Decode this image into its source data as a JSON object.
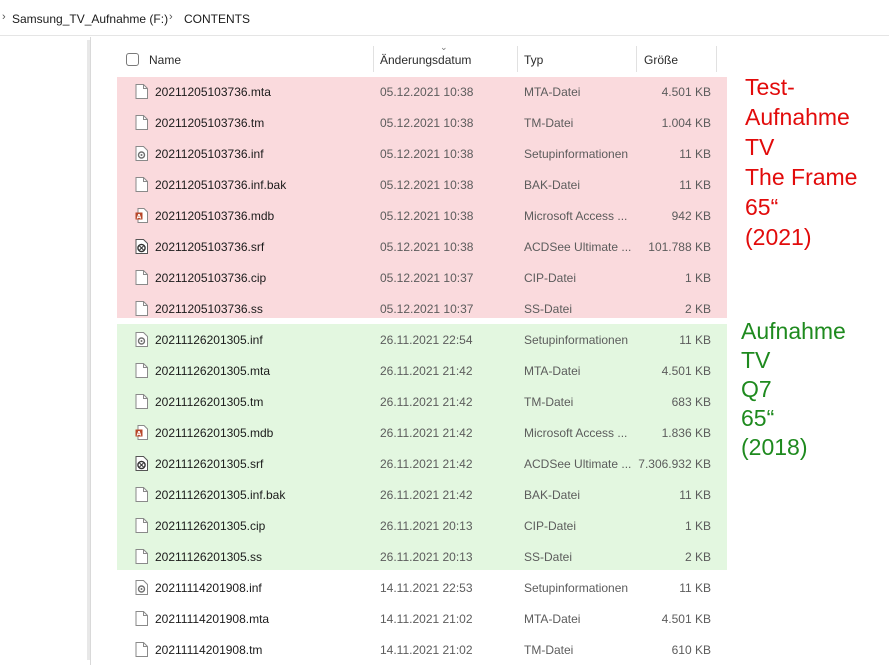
{
  "breadcrumb": {
    "items": [
      "Samsung_TV_Aufnahme (F:)",
      "CONTENTS"
    ]
  },
  "columns": {
    "name": "Name",
    "date": "Änderungsdatum",
    "type": "Typ",
    "size": "Größe"
  },
  "files": [
    {
      "name": "20211205103736.mta",
      "date": "05.12.2021 10:38",
      "type": "MTA-Datei",
      "size": "4.501 KB",
      "icon": "file-icon"
    },
    {
      "name": "20211205103736.tm",
      "date": "05.12.2021 10:38",
      "type": "TM-Datei",
      "size": "1.004 KB",
      "icon": "file-icon"
    },
    {
      "name": "20211205103736.inf",
      "date": "05.12.2021 10:38",
      "type": "Setupinformationen",
      "size": "11 KB",
      "icon": "setup-file-icon"
    },
    {
      "name": "20211205103736.inf.bak",
      "date": "05.12.2021 10:38",
      "type": "BAK-Datei",
      "size": "11 KB",
      "icon": "file-icon"
    },
    {
      "name": "20211205103736.mdb",
      "date": "05.12.2021 10:38",
      "type": "Microsoft Access ...",
      "size": "942 KB",
      "icon": "access-file-icon"
    },
    {
      "name": "20211205103736.srf",
      "date": "05.12.2021 10:38",
      "type": "ACDSee Ultimate ...",
      "size": "101.788 KB",
      "icon": "acdsee-file-icon"
    },
    {
      "name": "20211205103736.cip",
      "date": "05.12.2021 10:37",
      "type": "CIP-Datei",
      "size": "1 KB",
      "icon": "file-icon"
    },
    {
      "name": "20211205103736.ss",
      "date": "05.12.2021 10:37",
      "type": "SS-Datei",
      "size": "2 KB",
      "icon": "file-icon"
    },
    {
      "name": "20211126201305.inf",
      "date": "26.11.2021 22:54",
      "type": "Setupinformationen",
      "size": "11 KB",
      "icon": "setup-file-icon"
    },
    {
      "name": "20211126201305.mta",
      "date": "26.11.2021 21:42",
      "type": "MTA-Datei",
      "size": "4.501 KB",
      "icon": "file-icon"
    },
    {
      "name": "20211126201305.tm",
      "date": "26.11.2021 21:42",
      "type": "TM-Datei",
      "size": "683 KB",
      "icon": "file-icon"
    },
    {
      "name": "20211126201305.mdb",
      "date": "26.11.2021 21:42",
      "type": "Microsoft Access ...",
      "size": "1.836 KB",
      "icon": "access-file-icon"
    },
    {
      "name": "20211126201305.srf",
      "date": "26.11.2021 21:42",
      "type": "ACDSee Ultimate ...",
      "size": "7.306.932 KB",
      "icon": "acdsee-file-icon"
    },
    {
      "name": "20211126201305.inf.bak",
      "date": "26.11.2021 21:42",
      "type": "BAK-Datei",
      "size": "11 KB",
      "icon": "file-icon"
    },
    {
      "name": "20211126201305.cip",
      "date": "26.11.2021 20:13",
      "type": "CIP-Datei",
      "size": "1 KB",
      "icon": "file-icon"
    },
    {
      "name": "20211126201305.ss",
      "date": "26.11.2021 20:13",
      "type": "SS-Datei",
      "size": "2 KB",
      "icon": "file-icon"
    },
    {
      "name": "20211114201908.inf",
      "date": "14.11.2021 22:53",
      "type": "Setupinformationen",
      "size": "11 KB",
      "icon": "setup-file-icon"
    },
    {
      "name": "20211114201908.mta",
      "date": "14.11.2021 21:02",
      "type": "MTA-Datei",
      "size": "4.501 KB",
      "icon": "file-icon"
    },
    {
      "name": "20211114201908.tm",
      "date": "14.11.2021 21:02",
      "type": "TM-Datei",
      "size": "610 KB",
      "icon": "file-icon"
    }
  ],
  "annotations": {
    "red": {
      "lines": [
        "Test-",
        "Aufnahme",
        "TV",
        "The Frame",
        "65“",
        "(2021)"
      ],
      "color": "#e20b0b"
    },
    "green": {
      "lines": [
        "Aufnahme",
        "TV",
        "Q7",
        "65“",
        "(2018)"
      ],
      "color": "#1e8a1e"
    }
  },
  "colors": {
    "highlight_red": "#fadadd",
    "highlight_green": "#e3f7e0"
  }
}
